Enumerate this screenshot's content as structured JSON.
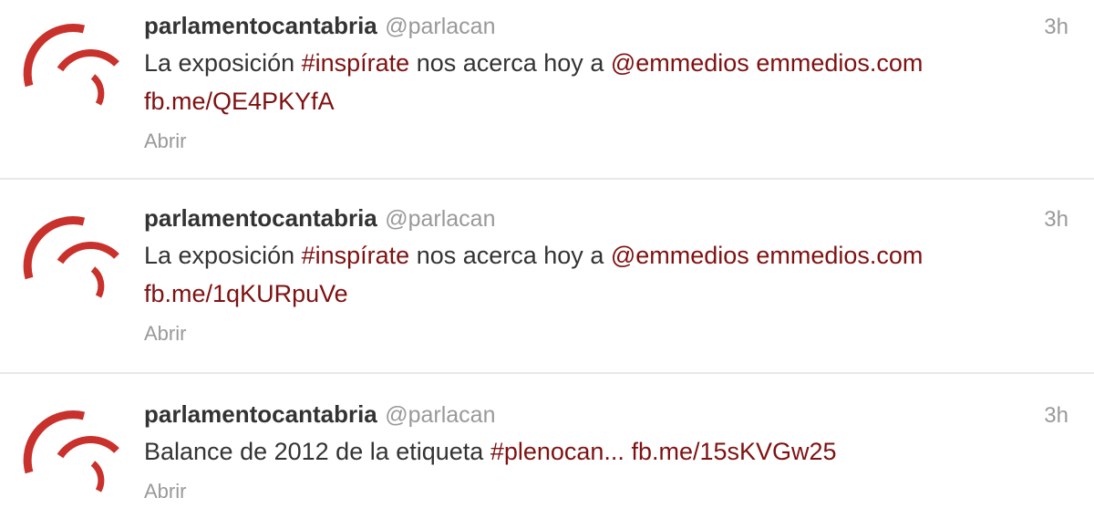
{
  "accent_color": "#7f1111",
  "avatar": {
    "icon": "parlamento-logo-icon",
    "color": "#c8312c"
  },
  "tweets": [
    {
      "fullname": "parlamentocantabria",
      "username": "@parlacan",
      "time": "3h",
      "text_1": "La exposición ",
      "hashtag": "#inspírate",
      "text_2": " nos acerca hoy a ",
      "mention": "@emmedios",
      "text_3": " ",
      "link_1": "emmedios.com",
      "link_2": "fb.me/QE4PKYfA",
      "action": "Abrir"
    },
    {
      "fullname": "parlamentocantabria",
      "username": "@parlacan",
      "time": "3h",
      "text_1": "La exposición ",
      "hashtag": "#inspírate",
      "text_2": " nos acerca hoy a ",
      "mention": "@emmedios",
      "text_3": " ",
      "link_1": "emmedios.com",
      "link_2": "fb.me/1qKURpuVe",
      "action": "Abrir"
    },
    {
      "fullname": "parlamentocantabria",
      "username": "@parlacan",
      "time": "3h",
      "text_1": "Balance de 2012 de la etiqueta ",
      "hashtag": "#plenocan...",
      "text_2": " ",
      "link": "fb.me/15sKVGw25",
      "action": "Abrir"
    }
  ]
}
